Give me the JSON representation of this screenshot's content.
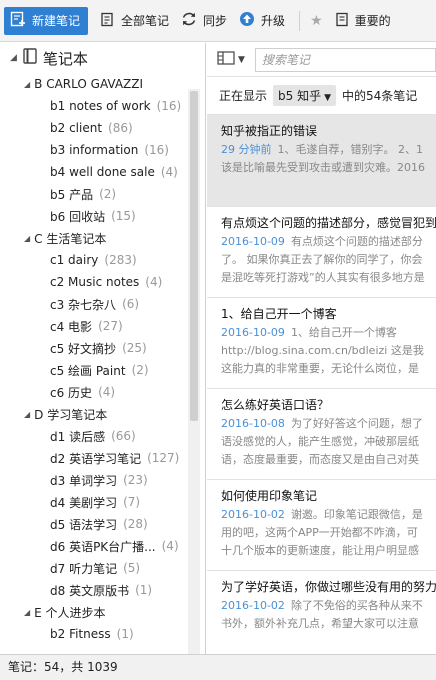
{
  "toolbar": {
    "new_note": "新建笔记",
    "all_notes": "全部笔记",
    "sync": "同步",
    "upgrade": "升级",
    "important": "重要的"
  },
  "sidebar": {
    "header": "笔记本",
    "items": [
      {
        "type": "stack",
        "label": "B CARLO GAVAZZI"
      },
      {
        "type": "nb",
        "label": "b1 notes of work",
        "count": "(16)"
      },
      {
        "type": "nb",
        "label": "b2 client",
        "count": "(86)"
      },
      {
        "type": "nb",
        "label": "b3 information",
        "count": "(16)"
      },
      {
        "type": "nb",
        "label": "b4 well done sale",
        "count": "(4)"
      },
      {
        "type": "nb",
        "label": "b5 产品",
        "count": "(2)"
      },
      {
        "type": "nb",
        "label": "b6 回收站",
        "count": "(15)"
      },
      {
        "type": "stack",
        "label": "C 生活笔记本"
      },
      {
        "type": "nb",
        "label": "c1 dairy",
        "count": "(283)"
      },
      {
        "type": "nb",
        "label": "c2 Music notes",
        "count": "(4)"
      },
      {
        "type": "nb",
        "label": "c3 杂七杂八",
        "count": "(6)"
      },
      {
        "type": "nb",
        "label": "c4 电影",
        "count": "(27)"
      },
      {
        "type": "nb",
        "label": "c5 好文摘抄",
        "count": "(25)"
      },
      {
        "type": "nb",
        "label": "c5 绘画 Paint",
        "count": "(2)"
      },
      {
        "type": "nb",
        "label": "c6 历史",
        "count": "(4)"
      },
      {
        "type": "stack",
        "label": "D 学习笔记本"
      },
      {
        "type": "nb",
        "label": "d1 读后感",
        "count": "(66)"
      },
      {
        "type": "nb",
        "label": "d2 英语学习笔记",
        "count": "(127)"
      },
      {
        "type": "nb",
        "label": "d3 单词学习",
        "count": "(23)"
      },
      {
        "type": "nb",
        "label": "d4 美剧学习",
        "count": "(7)"
      },
      {
        "type": "nb",
        "label": "d5 语法学习",
        "count": "(28)"
      },
      {
        "type": "nb",
        "label": "d6 英语PK台广播...",
        "count": "(4)"
      },
      {
        "type": "nb",
        "label": "d7 听力笔记",
        "count": "(5)"
      },
      {
        "type": "nb",
        "label": "d8 英文原版书",
        "count": "(1)"
      },
      {
        "type": "stack",
        "label": "E 个人进步本"
      },
      {
        "type": "nb",
        "label": "b2 Fitness",
        "count": "(1)"
      }
    ]
  },
  "notelist": {
    "search_placeholder": "搜索笔记",
    "showing_prefix": "正在显示",
    "filter": "b5 知乎",
    "showing_suffix": "中的54条笔记",
    "notes": [
      {
        "title": "知乎被指正的错误",
        "date": "29 分钟前",
        "line1": "1、毛遂自荐，错别字。 2、1",
        "line2": "该是比喻最先受到攻击或遭到灾难。2016"
      },
      {
        "title": "有点烦这个问题的描述部分，感觉冒犯到我了",
        "date": "2016-10-09",
        "line1": "有点烦这个问题的描述部分",
        "line2": "了。 如果你真正去了解你的同学了，你会",
        "line3": "是混吃等死打游戏”的人其实有很多地方是"
      },
      {
        "title": "1、给自己开一个博客",
        "date": "2016-10-09",
        "line1": "1、给自己开一个博客",
        "line2": "http://blog.sina.com.cn/bdleizi 这是我",
        "line3": "这能力真的非常重要，无论什么岗位，是"
      },
      {
        "title": "怎么练好英语口语？",
        "date": "2016-10-08",
        "line1": "为了好好答这个问题，想了",
        "line2": "语没感觉的人，能产生感觉，冲破那层纸",
        "line3": "语，态度最重要，而态度又是由自己对英"
      },
      {
        "title": "如何使用印象笔记",
        "date": "2016-10-02",
        "line1": "谢邀。印象笔记跟微信，是",
        "line2": "用的吧，这两个APP一开始都不咋滴，可",
        "line3": "十几个版本的更新速度，能让用户明显感"
      },
      {
        "title": "为了学好英语，你做过哪些没有用的努力？",
        "date": "2016-10-02",
        "line1": "除了不免俗的买各种从来不",
        "line2": "书外，额外补充几点，希望大家可以注意"
      }
    ]
  },
  "status": "笔记：54，共 1039"
}
